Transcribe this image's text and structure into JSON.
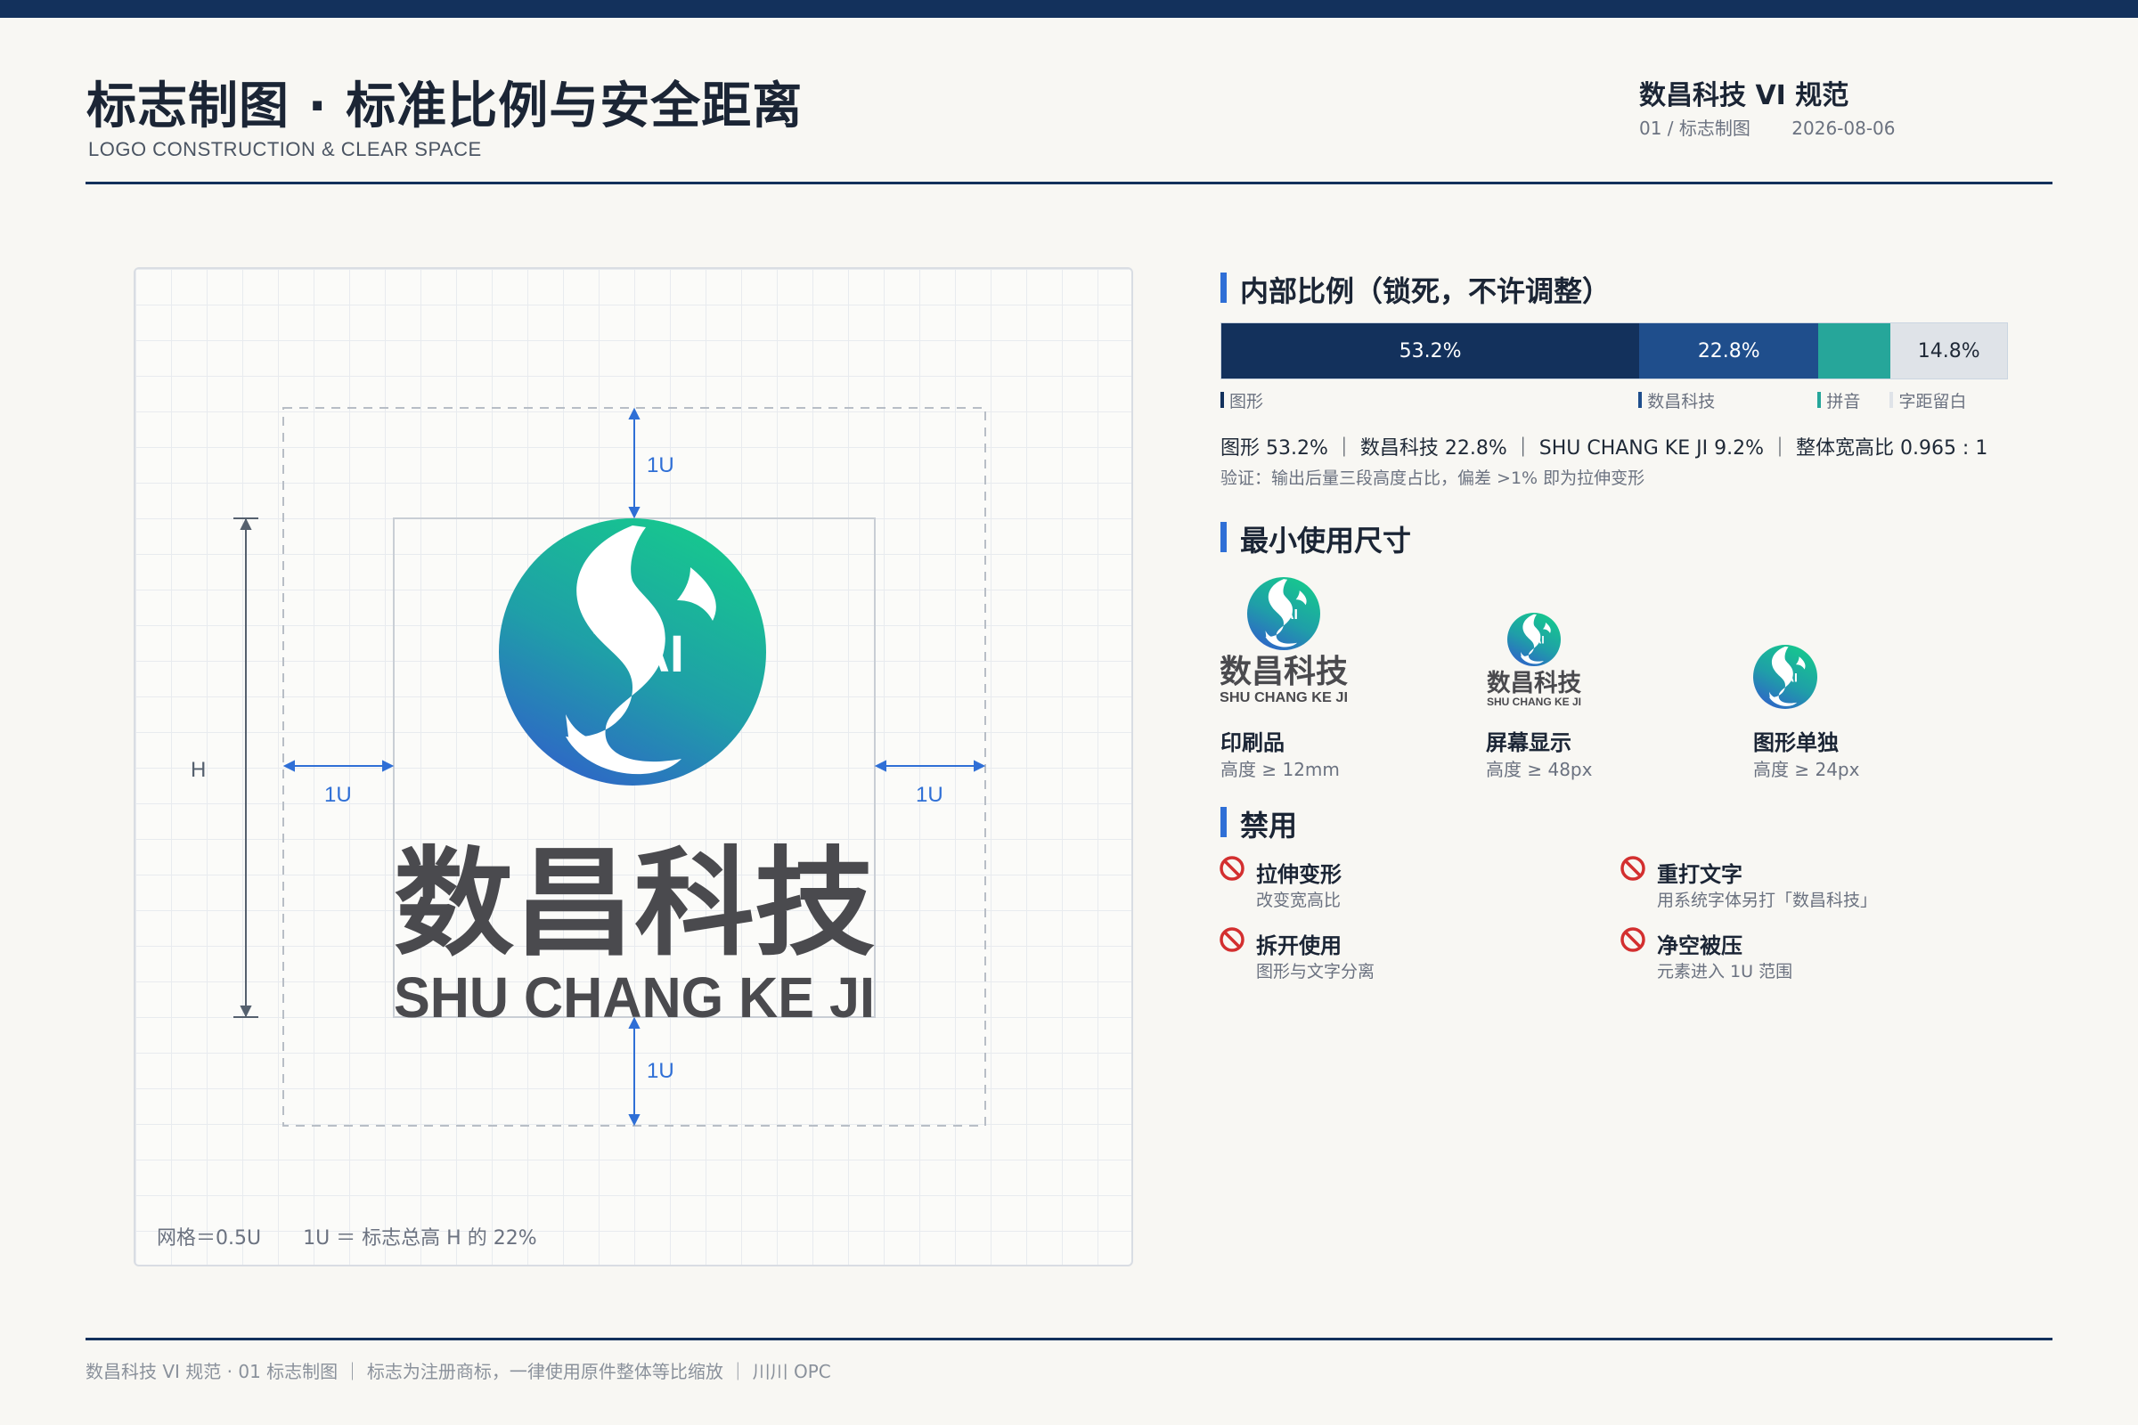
{
  "header": {
    "title": "标志制图 · 标准比例与安全距离",
    "subtitle": "LOGO CONSTRUCTION & CLEAR SPACE",
    "brand": "数昌科技 VI 规范",
    "section": "01 / 标志制图",
    "date": "2026-08-06"
  },
  "construction": {
    "logo_cn": "数昌科技",
    "logo_en": "SHU CHANG KE JI",
    "logo_badge": "AI",
    "label_top": "1U",
    "label_left": "1U",
    "label_right": "1U",
    "label_bottom": "1U",
    "label_height": "H",
    "note_grid": "网格＝0.5U",
    "note_unit": "1U ＝ 标志总高 H 的 22%"
  },
  "ratio": {
    "title": "内部比例（锁死，不许调整）",
    "segments": [
      {
        "value": 53.2,
        "text": "53.2%",
        "color": "#13315c"
      },
      {
        "value": 22.8,
        "text": "22.8%",
        "color": "#1f4e8c"
      },
      {
        "value": 9.2,
        "text": "",
        "color": "#26a69a"
      },
      {
        "value": 14.8,
        "text": "14.8%",
        "color": "#dfe3e8"
      }
    ],
    "legend": [
      "图形",
      "数昌科技",
      "拼音",
      "字距留白"
    ],
    "summary": "图形 53.2% ｜ 数昌科技 22.8% ｜ SHU CHANG KE JI 9.2% ｜ 整体宽高比 0.965 : 1",
    "verify": "验证：输出后量三段高度占比，偏差 >1% 即为拉伸变形"
  },
  "min_size": {
    "title": "最小使用尺寸",
    "items": [
      {
        "name": "印刷品",
        "req": "高度 ≥ 12mm"
      },
      {
        "name": "屏幕显示",
        "req": "高度 ≥ 48px"
      },
      {
        "name": "图形单独",
        "req": "高度 ≥ 24px"
      }
    ]
  },
  "forbidden": {
    "title": "禁用",
    "items": [
      {
        "name": "拉伸变形",
        "desc": "改变宽高比"
      },
      {
        "name": "重打文字",
        "desc": "用系统字体另打「数昌科技」"
      },
      {
        "name": "拆开使用",
        "desc": "图形与文字分离"
      },
      {
        "name": "净空被压",
        "desc": "元素进入 1U 范围"
      }
    ]
  },
  "footer": {
    "text": "数昌科技 VI 规范 · 01 标志制图 ｜ 标志为注册商标，一律使用原件整体等比缩放 ｜ 川川 OPC"
  },
  "colors": {
    "navy": "#13315c",
    "accent_blue": "#2f6fd6",
    "teal": "#26a69a",
    "ban_red": "#d32f2f"
  }
}
